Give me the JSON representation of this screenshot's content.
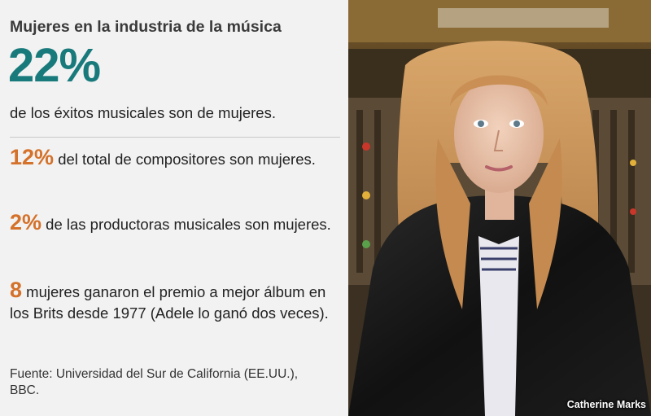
{
  "infographic": {
    "title": "Mujeres en la industria de la música",
    "headline_value": "22%",
    "headline_text": "de los éxitos musicales son de mujeres.",
    "stats": [
      {
        "value": "12%",
        "text": "del total de compositores son mujeres."
      },
      {
        "value": "2%",
        "text": "de las productoras musicales son mujeres."
      },
      {
        "value": "8",
        "text": "mujeres ganaron el premio a mejor álbum en los Brits desde 1977 (Adele lo ganó dos veces)."
      }
    ],
    "source": "Fuente: Universidad del Sur de California (EE.UU.), BBC."
  },
  "photo": {
    "credit": "Catherine Marks"
  },
  "colors": {
    "headline": "#197a7c",
    "stat_accent": "#d4712a",
    "panel_bg": "#f2f2f2"
  }
}
